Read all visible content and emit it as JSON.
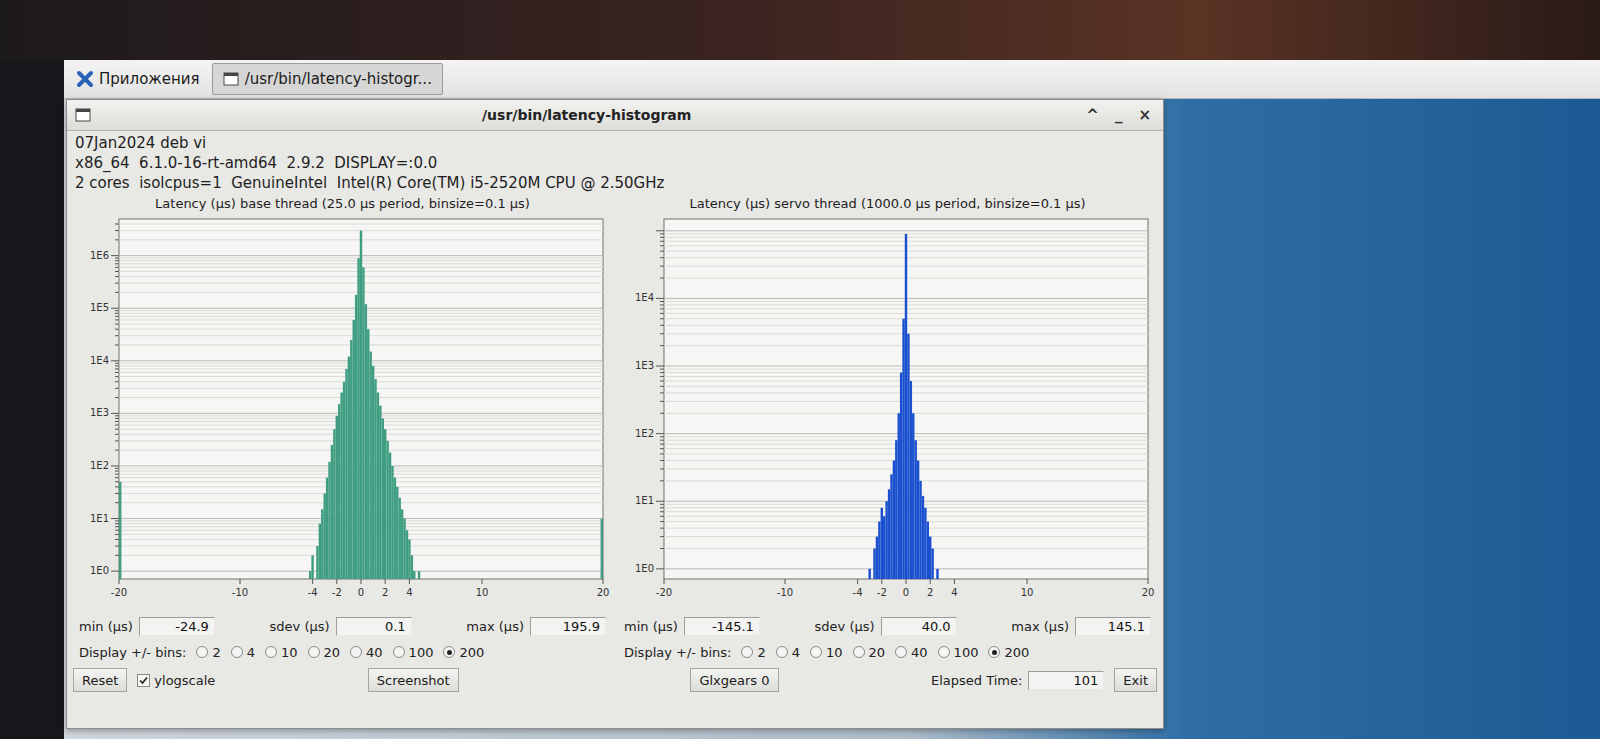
{
  "taskbar": {
    "menu": "Приложения",
    "tasks": [
      {
        "label": "/usr/bin/latency-histogr...",
        "selected": true
      }
    ]
  },
  "window": {
    "title": "/usr/bin/latency-histogram",
    "controls": [
      "^",
      "_",
      "×"
    ]
  },
  "info": [
    "07Jan2024 deb vi",
    "x86_64  6.1.0-16-rt-amd64  2.9.2  DISPLAY=:0.0",
    "2 cores  isolcpus=1  GenuineIntel  Intel(R) Core(TM) i5-2520M CPU @ 2.50GHz"
  ],
  "charts": [
    {
      "title": "Latency (µs) base thread (25.0 µs period, binsize=0.1 µs)",
      "color": "#3f9e82",
      "y_ticks": [
        "1E0",
        "1E1",
        "1E2",
        "1E3",
        "1E4",
        "1E5",
        "1E6"
      ],
      "x_ticks": [
        "-20",
        "-10",
        "-4",
        "-2",
        "0",
        "2",
        "4",
        "10",
        "20"
      ],
      "x": [
        -20,
        -4.2,
        -4.0,
        -3.6,
        -3.4,
        -3.2,
        -3.0,
        -2.8,
        -2.6,
        -2.4,
        -2.2,
        -2.0,
        -1.8,
        -1.6,
        -1.4,
        -1.2,
        -1.0,
        -0.8,
        -0.6,
        -0.4,
        -0.2,
        0,
        0.2,
        0.4,
        0.6,
        0.8,
        1.0,
        1.2,
        1.4,
        1.6,
        1.8,
        2.0,
        2.2,
        2.4,
        2.6,
        2.8,
        3.0,
        3.2,
        3.4,
        3.6,
        3.8,
        4.0,
        4.2,
        4.4,
        4.8,
        19.9
      ],
      "counts": [
        50,
        1,
        2,
        3,
        8,
        15,
        30,
        60,
        120,
        250,
        500,
        900,
        1500,
        2500,
        4000,
        7000,
        12000,
        25000,
        60000,
        180000,
        900000,
        3000000,
        600000,
        120000,
        40000,
        15000,
        8000,
        4500,
        2500,
        1400,
        800,
        500,
        300,
        180,
        100,
        60,
        40,
        25,
        15,
        10,
        6,
        4,
        2,
        1,
        1,
        10
      ],
      "stats": [
        {
          "label": "min (µs)",
          "value": "-24.9"
        },
        {
          "label": "sdev (µs)",
          "value": "0.1"
        },
        {
          "label": "max (µs)",
          "value": "195.9"
        }
      ],
      "bins_label": "Display +/- bins:",
      "bins": [
        {
          "label": "2",
          "selected": false
        },
        {
          "label": "4",
          "selected": false
        },
        {
          "label": "10",
          "selected": false
        },
        {
          "label": "20",
          "selected": false
        },
        {
          "label": "40",
          "selected": false
        },
        {
          "label": "100",
          "selected": false
        },
        {
          "label": "200",
          "selected": true
        }
      ]
    },
    {
      "title": "Latency (µs) servo thread (1000.0 µs period, binsize=0.1 µs)",
      "color": "#1a4fd0",
      "y_ticks": [
        "1E0",
        "1E1",
        "1E2",
        "1E3",
        "1E4"
      ],
      "x_ticks": [
        "-20",
        "-10",
        "-4",
        "-2",
        "0",
        "2",
        "4",
        "10",
        "20"
      ],
      "x": [
        -3.0,
        -2.6,
        -2.4,
        -2.2,
        -2.0,
        -1.8,
        -1.6,
        -1.4,
        -1.2,
        -1.0,
        -0.8,
        -0.6,
        -0.4,
        -0.2,
        0,
        0.2,
        0.4,
        0.6,
        0.8,
        1.0,
        1.2,
        1.4,
        1.6,
        1.8,
        2.0,
        2.2,
        2.6
      ],
      "counts": [
        1,
        2,
        3,
        5,
        8,
        6,
        10,
        15,
        25,
        40,
        80,
        200,
        800,
        5000,
        90000,
        3000,
        600,
        200,
        80,
        40,
        20,
        12,
        8,
        5,
        3,
        2,
        1
      ],
      "stats": [
        {
          "label": "min (µs)",
          "value": "-145.1"
        },
        {
          "label": "sdev (µs)",
          "value": "40.0"
        },
        {
          "label": "max (µs)",
          "value": "145.1"
        }
      ],
      "bins_label": "Display +/- bins:",
      "bins": [
        {
          "label": "2",
          "selected": false
        },
        {
          "label": "4",
          "selected": false
        },
        {
          "label": "10",
          "selected": false
        },
        {
          "label": "20",
          "selected": false
        },
        {
          "label": "40",
          "selected": false
        },
        {
          "label": "100",
          "selected": false
        },
        {
          "label": "200",
          "selected": true
        }
      ]
    }
  ],
  "controls": {
    "reset": "Reset",
    "ylogscale": {
      "label": "ylogscale",
      "checked": true
    },
    "screenshot": "Screenshot",
    "glxgears": "Glxgears 0",
    "elapsed_label": "Elapsed Time:",
    "elapsed": "101",
    "exit": "Exit"
  }
}
